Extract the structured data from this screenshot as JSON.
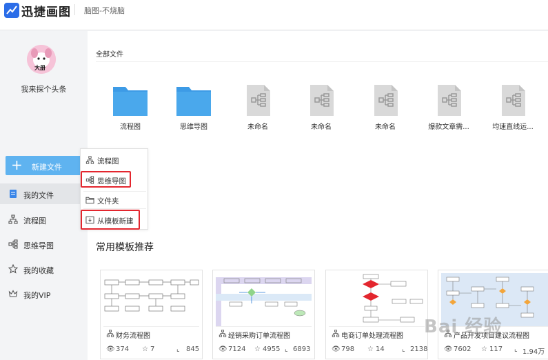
{
  "app": {
    "name": "迅捷画图",
    "slogan": "脑图-不烧脑"
  },
  "user": {
    "name": "我来探个头条",
    "avatar_text": "大册"
  },
  "sidebar": {
    "new_button": "新建文件",
    "items": [
      {
        "label": "我的文件",
        "icon": "document-icon"
      },
      {
        "label": "流程图",
        "icon": "flowchart-icon"
      },
      {
        "label": "思维导图",
        "icon": "mindmap-icon"
      },
      {
        "label": "我的收藏",
        "icon": "star-icon"
      },
      {
        "label": "我的VIP",
        "icon": "crown-icon"
      }
    ]
  },
  "dropdown": {
    "items": [
      {
        "label": "流程图",
        "icon": "flowchart-icon"
      },
      {
        "label": "思维导图",
        "icon": "mindmap-icon"
      },
      {
        "label": "文件夹",
        "icon": "folder-icon"
      },
      {
        "label": "从模板新建",
        "icon": "template-icon"
      }
    ]
  },
  "files": {
    "section_title": "全部文件",
    "items": [
      {
        "name": "流程图",
        "type": "folder"
      },
      {
        "name": "思维导图",
        "type": "folder"
      },
      {
        "name": "未命名",
        "type": "doc"
      },
      {
        "name": "未命名",
        "type": "doc"
      },
      {
        "name": "未命名",
        "type": "doc"
      },
      {
        "name": "爆款文章需...",
        "type": "doc"
      },
      {
        "name": "均速直线运...",
        "type": "doc"
      }
    ]
  },
  "templates": {
    "title": "常用模板推荐",
    "cards": [
      {
        "name": "财务流程图",
        "views": "374",
        "likes": "7",
        "uses": "845"
      },
      {
        "name": "经销采购订单流程图",
        "views": "7124",
        "likes": "4955",
        "uses": "6893"
      },
      {
        "name": "电商订单处理流程图",
        "views": "798",
        "likes": "14",
        "uses": "2138"
      },
      {
        "name": "产品开发项目建议流程图",
        "views": "7602",
        "likes": "117",
        "uses": "1.94万"
      }
    ]
  },
  "watermark": "Bai 经验",
  "colors": {
    "accent": "#5fb3f0",
    "folder": "#4aa8ec",
    "highlight": "#e3262e",
    "brand": "#2b6de8"
  }
}
